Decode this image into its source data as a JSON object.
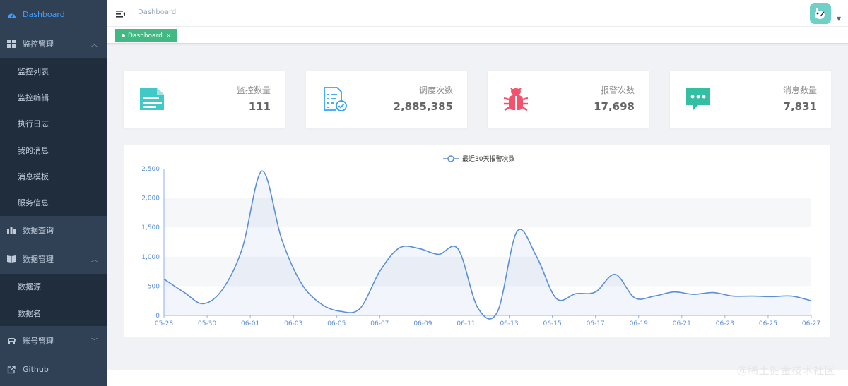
{
  "sidebar": {
    "dashboard": "Dashboard",
    "monitor_group": "监控管理",
    "monitor_items": [
      "监控列表",
      "监控编辑",
      "执行日志",
      "我的消息",
      "消息模板",
      "服务信息"
    ],
    "query_group": "数据查询",
    "data_group": "数据管理",
    "data_items": [
      "数据源",
      "数据名"
    ],
    "account_group": "账号管理",
    "github": "Github"
  },
  "header": {
    "breadcrumb": "Dashboard"
  },
  "tags": {
    "active": "Dashboard",
    "close": "×"
  },
  "cards": [
    {
      "label": "监控数量",
      "value": "111",
      "icon": "document-icon",
      "color": "#40c9c6"
    },
    {
      "label": "调度次数",
      "value": "2,885,385",
      "icon": "checklist-icon",
      "color": "#36a3f7"
    },
    {
      "label": "报警次数",
      "value": "17,698",
      "icon": "bug-icon",
      "color": "#f4516c"
    },
    {
      "label": "消息数量",
      "value": "7,831",
      "icon": "message-icon",
      "color": "#34bfa3"
    }
  ],
  "chart_data": {
    "type": "line",
    "series": [
      {
        "name": "最近30天报警次数",
        "values": [
          620,
          400,
          200,
          450,
          1150,
          2460,
          1300,
          550,
          200,
          70,
          120,
          750,
          1150,
          1140,
          1040,
          1130,
          130,
          60,
          1430,
          1000,
          290,
          370,
          400,
          700,
          300,
          330,
          400,
          360,
          390,
          330,
          330,
          320,
          330,
          250
        ]
      }
    ],
    "x_ticks": [
      "05-28",
      "05-30",
      "06-01",
      "06-03",
      "06-05",
      "06-07",
      "06-09",
      "06-11",
      "06-13",
      "06-15",
      "06-17",
      "06-19",
      "06-21",
      "06-23",
      "06-25",
      "06-27"
    ],
    "y_ticks": [
      "0",
      "500",
      "1,000",
      "1,500",
      "2,000",
      "2,500"
    ],
    "ylim": [
      0,
      2500
    ],
    "legend_position": "top-center",
    "line_color": "#5b8fd9"
  },
  "watermark": "@稀土掘金技术社区"
}
